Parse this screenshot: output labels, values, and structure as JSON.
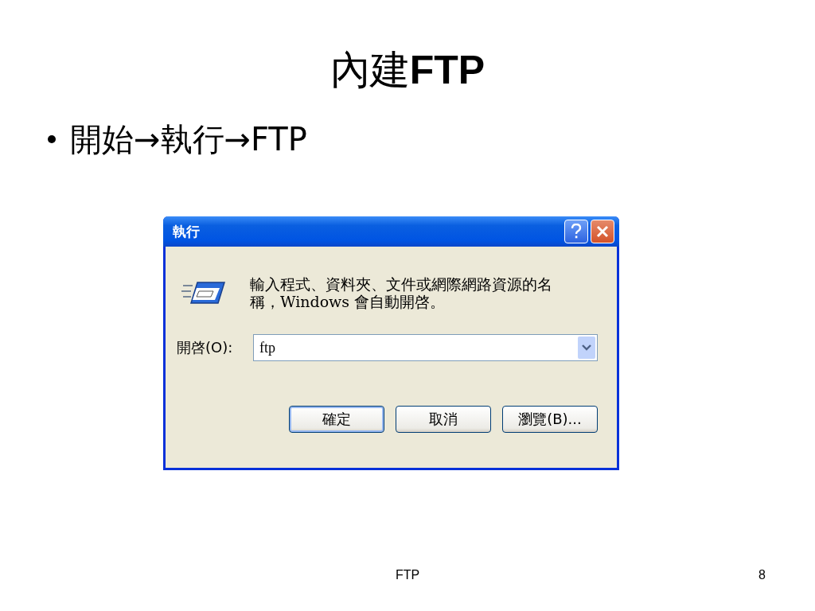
{
  "slide": {
    "title": "內建**FTP**",
    "bullets": [
      "開始→執行→FTP"
    ],
    "footer": "FTP",
    "page_number": "8"
  },
  "dialog": {
    "title": "執行",
    "description": "輸入程式、資料夾、文件或網際網路資源的名稱，Windows 會自動開啓。",
    "open_label": "開啓(O):",
    "open_value": "ftp",
    "buttons": [
      {
        "label": "確定",
        "default": true
      },
      {
        "label": "取消",
        "default": false
      },
      {
        "label": "瀏覽(B)...",
        "default": false
      }
    ]
  }
}
